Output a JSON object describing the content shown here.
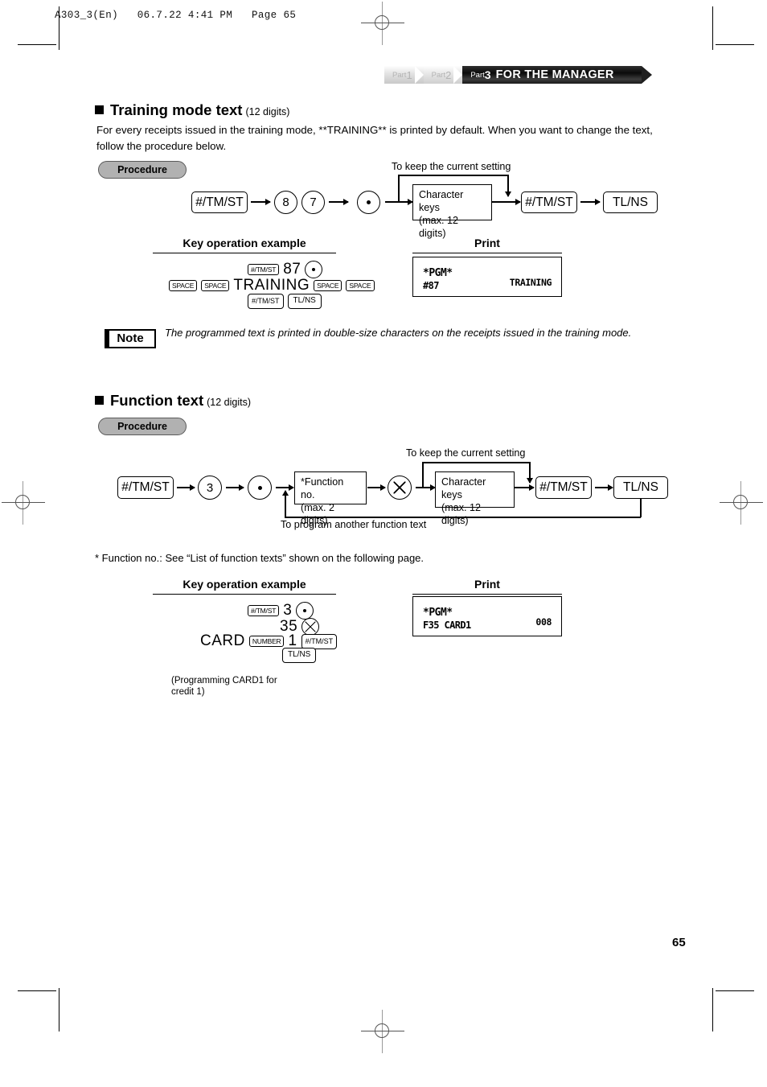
{
  "print_header": "A303_3(En)   06.7.22 4:41 PM   Page 65",
  "banner": {
    "part1_prefix": "Part",
    "part1_num": "1",
    "part2_prefix": "Part",
    "part2_num": "2",
    "part3_prefix": "Part",
    "part3_num": "3",
    "part3_title": "FOR THE MANAGER"
  },
  "section1": {
    "heading": "Training mode text",
    "heading_sub": "(12 digits)",
    "paragraph": "For every receipts issued in the training mode, **TRAINING** is printed by default.  When you want to change the text, follow the procedure below.",
    "procedure_label": "Procedure",
    "flow": {
      "key1": "#/TM/ST",
      "key2": "8",
      "key3": "7",
      "box_char_line1": "Character keys",
      "box_char_line2": "(max. 12 digits)",
      "key4": "#/TM/ST",
      "key5": "TL/NS",
      "bypass_label": "To keep the current setting"
    },
    "example_title": "Key operation example",
    "print_title": "Print",
    "example": {
      "row1_key": "#/TM/ST",
      "row1_num": "87",
      "row2_space1": "SPACE",
      "row2_space2": "SPACE",
      "row2_text": "TRAINING",
      "row2_space3": "SPACE",
      "row2_space4": "SPACE",
      "row3_key1": "#/TM/ST",
      "row3_key2": "TL/NS"
    },
    "print": {
      "line1": "*PGM*",
      "line2_left": "#87",
      "line2_right": "TRAINING"
    },
    "note_label": "Note",
    "note_text": "The programmed text is printed in double-size characters on the receipts issued in the training mode."
  },
  "section2": {
    "heading": "Function text",
    "heading_sub": "(12 digits)",
    "procedure_label": "Procedure",
    "flow": {
      "key1": "#/TM/ST",
      "key2": "3",
      "box_fn_line1": "*Function no.",
      "box_fn_line2": "(max. 2 digits)",
      "box_char_line1": "Character keys",
      "box_char_line2": "(max. 12 digits)",
      "key4": "#/TM/ST",
      "key5": "TL/NS",
      "bypass_label": "To keep the current setting",
      "loop_label": "To program another function text"
    },
    "footnote": "* Function no.: See “List of function texts” shown on the following page.",
    "example_title": "Key operation example",
    "print_title": "Print",
    "example": {
      "row1_key": "#/TM/ST",
      "row1_num": "3",
      "row2_num": "35",
      "row3_text": "CARD",
      "row3_number_key": "NUMBER",
      "row3_num": "1",
      "row3_key": "#/TM/ST",
      "row4_key": "TL/NS",
      "caption_line1": "(Programming CARD1 for",
      "caption_line2": "credit 1)"
    },
    "print": {
      "line1": "*PGM*",
      "line2_left_bold": "F",
      "line2_left_rest": "35 CARD1",
      "line2_right": "008"
    }
  },
  "page_number": "65"
}
